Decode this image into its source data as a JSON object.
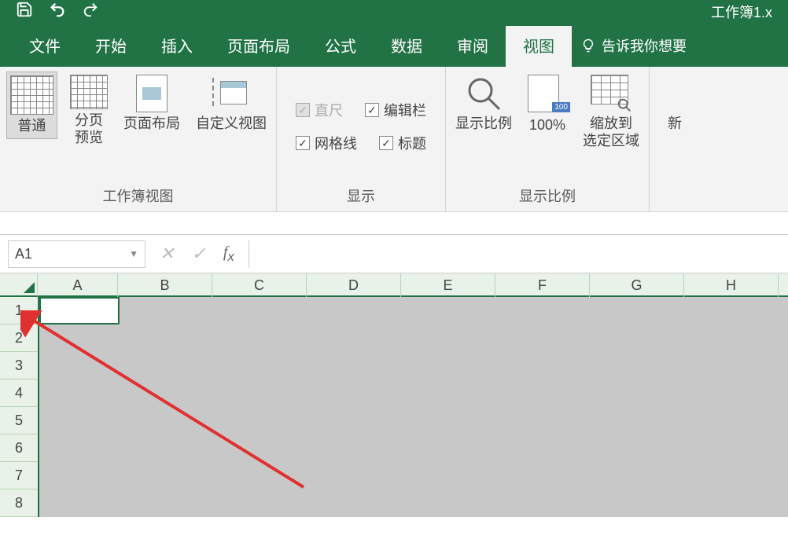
{
  "titlebar": {
    "title": "工作簿1.x"
  },
  "menu": {
    "file": "文件",
    "home": "开始",
    "insert": "插入",
    "page_layout": "页面布局",
    "formulas": "公式",
    "data": "数据",
    "review": "审阅",
    "view": "视图",
    "tell_me": "告诉我你想要"
  },
  "ribbon": {
    "views": {
      "normal": "普通",
      "page_break": "分页\n预览",
      "page_layout": "页面布局",
      "custom": "自定义视图",
      "group_label": "工作簿视图"
    },
    "show": {
      "ruler": "直尺",
      "formula_bar": "编辑栏",
      "gridlines": "网格线",
      "headings": "标题",
      "group_label": "显示"
    },
    "zoom": {
      "zoom": "显示比例",
      "hundred": "100%",
      "selection": "缩放到\n选定区域",
      "new_window": "新",
      "group_label": "显示比例"
    }
  },
  "namebox": {
    "value": "A1"
  },
  "columns": [
    "A",
    "B",
    "C",
    "D",
    "E",
    "F",
    "G",
    "H"
  ],
  "rows": [
    "1",
    "2",
    "3",
    "4",
    "5",
    "6",
    "7",
    "8"
  ]
}
